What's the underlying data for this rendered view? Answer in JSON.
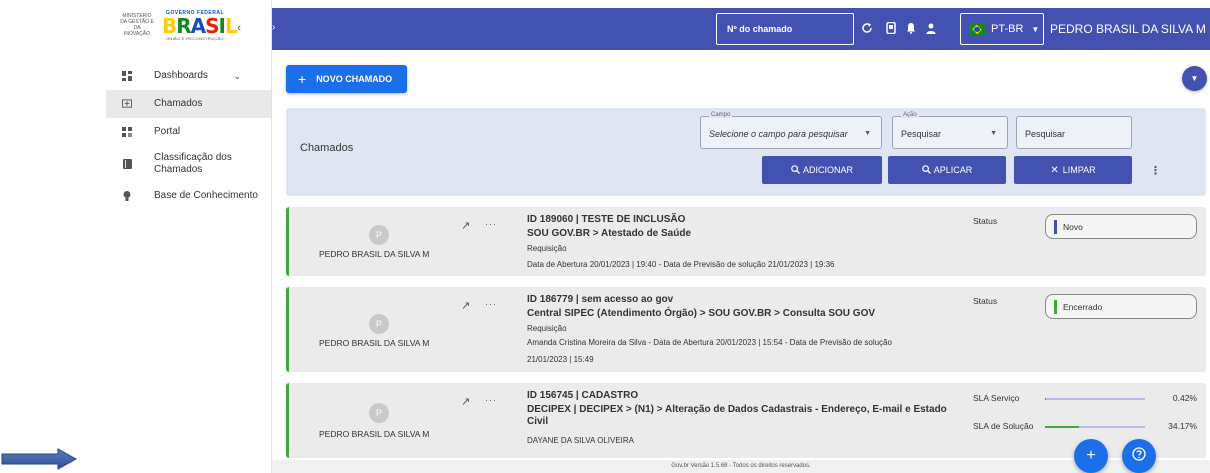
{
  "sidebar": {
    "ministerio": "MINISTÉRIO DA GESTÃO E DA INOVAÇÃO",
    "gov_federal": "GOVERNO FEDERAL",
    "brasil_letters": [
      "B",
      "R",
      "A",
      "S",
      "I",
      "L"
    ],
    "uniao": "UNIÃO E RECONSTRUÇÃO",
    "collapse_icon": "chevron-left-icon",
    "items": [
      {
        "label": "Dashboards",
        "icon": "dashboard-icon",
        "has_chevron": true
      },
      {
        "label": "Chamados",
        "icon": "ticket-icon",
        "active": true
      },
      {
        "label": "Portal",
        "icon": "portal-icon"
      },
      {
        "label": "Classificação dos Chamados",
        "icon": "book-icon"
      },
      {
        "label": "Base de Conhecimento",
        "icon": "lightbulb-icon"
      }
    ]
  },
  "topbar": {
    "search_placeholder": "Nº do chamado",
    "icons": [
      "refresh-icon",
      "phone-icon",
      "bell-icon",
      "user-icon"
    ],
    "language": "PT-BR",
    "username": "PEDRO BRASIL DA SILVA M"
  },
  "main": {
    "new_button": "NOVO CHAMADO",
    "filter": {
      "title": "Chamados",
      "campo_label": "Campo",
      "campo_value": "Selecione o campo para pesquisar",
      "acao_label": "Ação",
      "acao_value": "Pesquisar",
      "search_value": "Pesquisar",
      "btn_adicionar": "ADICIONAR",
      "btn_aplicar": "APLICAR",
      "btn_limpar": "LIMPAR"
    },
    "cards": [
      {
        "avatar": "P",
        "user": "PEDRO BRASIL DA SILVA M",
        "title": "ID 189060 | TESTE DE INCLUSÃO",
        "path": "SOU GOV.BR > Atestado de Saúde",
        "type": "Requisição",
        "dates": "Data de Abertura 20/01/2023 | 19:40 - Data de Previsão de solução 21/01/2023 | 19:36",
        "status_label": "Status",
        "status": "Novo",
        "status_color": "#4352b0"
      },
      {
        "avatar": "P",
        "user": "PEDRO BRASIL DA SILVA M",
        "title": "ID 186779 | sem acesso ao gov",
        "path": "Central SIPEC (Atendimento Órgão) > SOU GOV.BR > Consulta SOU GOV",
        "type": "Requisição",
        "dates_line1": "Amanda Cristina Moreira da Silva - Data de Abertura 20/01/2023 | 15:54 - Data de Previsão de solução",
        "dates_line2": "21/01/2023 | 15:49",
        "status_label": "Status",
        "status": "Encerrado",
        "status_color": "#3fa93a"
      },
      {
        "avatar": "P",
        "user": "PEDRO BRASIL DA SILVA M",
        "title": "ID 156745 | CADASTRO",
        "path": "DECIPEX | DECIPEX > (N1) > Alteração de Dados Cadastrais - Endereço, E-mail e Estado Civil",
        "assignee": "DAYANE DA SILVA OLIVEIRA",
        "sla_servico_label": "SLA Serviço",
        "sla_servico_value": "0.42%",
        "sla_servico_pct": 0.42,
        "sla_solucao_label": "SLA de Solução",
        "sla_solucao_value": "34.17%",
        "sla_solucao_pct": 34.17
      }
    ]
  },
  "footer": {
    "text": "Gov.br Versão 1.5.68 - Todos os direitos reservados."
  },
  "fabs": [
    "plus-icon",
    "help-icon"
  ],
  "colors": {
    "primary": "#4352b0",
    "accent": "#1b6fe8",
    "success": "#3fa93a"
  }
}
